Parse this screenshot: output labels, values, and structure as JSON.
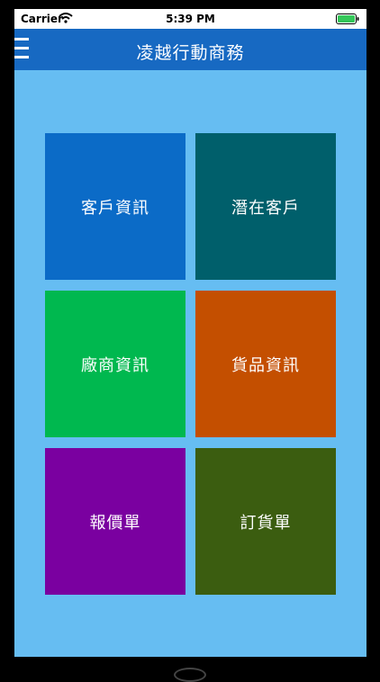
{
  "status_bar": {
    "carrier": "Carrier",
    "time": "5:39 PM",
    "icons": [
      "wifi-icon",
      "battery-icon"
    ],
    "battery_color": "#34c759"
  },
  "navbar": {
    "title": "凌越行動商務",
    "menu_icon": "hamburger-menu-icon",
    "color": "#1769c2"
  },
  "background_color": "#66bdf2",
  "tiles": [
    {
      "label": "客戶資訊",
      "color": "#0b6bc7"
    },
    {
      "label": "潛在客戶",
      "color": "#005f6b"
    },
    {
      "label": "廠商資訊",
      "color": "#00b84f"
    },
    {
      "label": "貨品資訊",
      "color": "#c44f00"
    },
    {
      "label": "報價單",
      "color": "#7a00a0"
    },
    {
      "label": "訂貨單",
      "color": "#3b5d10"
    }
  ]
}
